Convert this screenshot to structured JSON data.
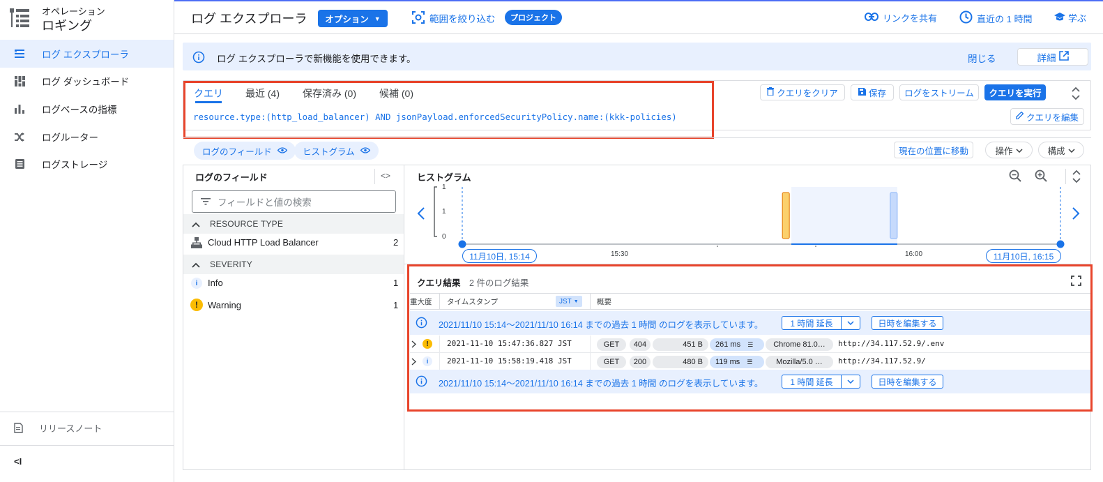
{
  "app": {
    "product": "オペレーション",
    "title": "ロギング"
  },
  "sidebar": {
    "items": [
      {
        "label": "ログ エクスプローラ",
        "icon": "list-icon"
      },
      {
        "label": "ログ ダッシュボード",
        "icon": "dashboard-icon"
      },
      {
        "label": "ログベースの指標",
        "icon": "bar-chart-icon"
      },
      {
        "label": "ログルーター",
        "icon": "shuffle-icon"
      },
      {
        "label": "ログストレージ",
        "icon": "storage-icon"
      }
    ],
    "release_notes": "リリースノート",
    "collapse": "<I"
  },
  "header": {
    "title": "ログ エクスプローラ",
    "options": "オプション",
    "refine_scope": "範囲を絞り込む",
    "scope_badge": "プロジェクト",
    "share_link": "リンクを共有",
    "time_range": "直近の 1 時間",
    "learn": "学ぶ"
  },
  "banner": {
    "text": "ログ エクスプローラで新機能を使用できます。",
    "close": "閉じる",
    "details": "詳細"
  },
  "query": {
    "tabs": [
      "クエリ",
      "最近 (4)",
      "保存済み (0)",
      "候補 (0)"
    ],
    "text": "resource.type:(http_load_balancer) AND jsonPayload.enforcedSecurityPolicy.name:(kkk-policies)",
    "clear": "クエリをクリア",
    "save": "保存",
    "stream": "ログをストリーム",
    "run": "クエリを実行",
    "edit": "クエリを編集"
  },
  "toolbar": {
    "fields_chip": "ログのフィールド",
    "histogram_chip": "ヒストグラム",
    "jump_now": "現在の位置に移動",
    "actions": "操作",
    "config": "構成"
  },
  "fields_panel": {
    "title": "ログのフィールド",
    "search_placeholder": "フィールドと値の検索",
    "resource_type_header": "RESOURCE TYPE",
    "resource": {
      "name": "Cloud HTTP Load Balancer",
      "count": "2"
    },
    "severity_header": "SEVERITY",
    "severities": [
      {
        "name": "Info",
        "count": "1"
      },
      {
        "name": "Warning",
        "count": "1"
      }
    ]
  },
  "histogram": {
    "title": "ヒストグラム",
    "y_ticks": [
      "1",
      "1",
      "0"
    ],
    "x_ticks": [
      "15:30",
      "16:00"
    ],
    "start_label": "11月10日, 15:14",
    "end_label": "11月10日, 16:15"
  },
  "chart_data": {
    "type": "bar",
    "categories": [
      "15:47",
      "15:58"
    ],
    "series": [
      {
        "values": [
          1,
          1
        ]
      }
    ],
    "colors": [
      "#fbd06d",
      "#c6dafc"
    ],
    "ylim": [
      0,
      1
    ]
  },
  "results": {
    "title": "クエリ結果",
    "count": "2 件のログ結果",
    "col_severity": "重大度",
    "col_timestamp": "タイムスタンプ",
    "tz": "JST",
    "col_summary": "概要",
    "info_text": "2021/11/10 15:14〜2021/11/10 16:14 までの過去 1 時間 のログを表示しています。",
    "extend": "1 時間 延長",
    "edit_time": "日時を編集する",
    "rows": [
      {
        "severity": "warning",
        "timestamp": "2021-11-10 15:47:36.827 JST",
        "method": "GET",
        "status": "404",
        "size": "451 B",
        "latency": "261 ms",
        "agent": "Chrome 81.0…",
        "url": "http://34.117.52.9/.env"
      },
      {
        "severity": "info",
        "timestamp": "2021-11-10 15:58:19.418 JST",
        "method": "GET",
        "status": "200",
        "size": "480 B",
        "latency": "119 ms",
        "agent": "Mozilla/5.0 …",
        "url": "http://34.117.52.9/"
      }
    ]
  }
}
